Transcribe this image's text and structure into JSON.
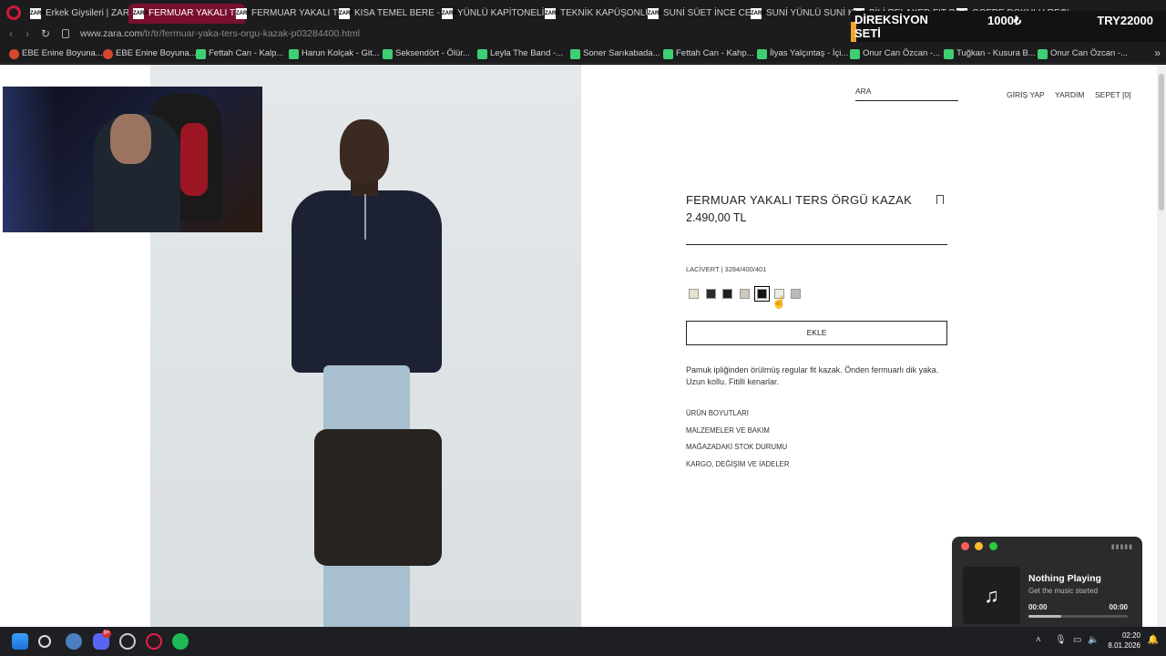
{
  "browser": {
    "tabs": [
      {
        "label": "Erkek Giysileri | ZARA",
        "active": false
      },
      {
        "label": "FERMUAR YAKALI TERS Ö",
        "active": true
      },
      {
        "label": "FERMUAR YAKALI TER",
        "active": false
      },
      {
        "label": "KISA TEMEL BERE - Z",
        "active": false
      },
      {
        "label": "YÜNLÜ KAPİTONELİ C",
        "active": false
      },
      {
        "label": "TEKNİK KAPÜŞONLU",
        "active": false
      },
      {
        "label": "SUNİ SÜET İNCE CEK",
        "active": false
      },
      {
        "label": "SUNİ YÜNLÜ SUNİ KU",
        "active": false
      },
      {
        "label": "BİLİ RELAXED FIT P",
        "active": false
      },
      {
        "label": "GOFRE DOKULU REGU",
        "active": false
      }
    ],
    "favicon_text": "ZARA",
    "url_host": "www.zara.com",
    "url_path": "/tr/tr/fermuar-yaka-ters-orgu-kazak-p03284400.html",
    "bookmarks": [
      {
        "label": "EBE Enine Boyuna...",
        "icon": "red"
      },
      {
        "label": "EBE Enine Boyuna...",
        "icon": "red"
      },
      {
        "label": "Fettah Can - Kalp...",
        "icon": "green"
      },
      {
        "label": "Harun Kolçak - Git...",
        "icon": "green"
      },
      {
        "label": "Seksendört - Ölür...",
        "icon": "green"
      },
      {
        "label": "Leyla The Band -...",
        "icon": "green"
      },
      {
        "label": "Soner Sarıkabada...",
        "icon": "green"
      },
      {
        "label": "Fettah Can - Kahp...",
        "icon": "green"
      },
      {
        "label": "İlyas Yalçıntaş - İçi...",
        "icon": "green"
      },
      {
        "label": "Onur Can Özcan -...",
        "icon": "green"
      },
      {
        "label": "Tuğkan - Kusura B...",
        "icon": "green"
      },
      {
        "label": "Onur Can Özcan -...",
        "icon": "green"
      }
    ]
  },
  "overlay": {
    "title": "DİREKSİYON SETİ",
    "amount": "1000₺",
    "total": "TRY22000",
    "accent_color": "#f2a52a"
  },
  "site": {
    "search_label": "ARA",
    "nav": [
      "GİRİŞ YAP",
      "YARDIM",
      "SEPET [0]"
    ]
  },
  "product": {
    "title": "FERMUAR YAKALI TERS ÖRGÜ KAZAK",
    "price": "2.490,00 TL",
    "color_code": "LACİVERT | 3284/400/401",
    "swatches": [
      "#e9e1cf",
      "#2e2b2b",
      "#1f1f24",
      "#cfc9bc",
      "#141418",
      "#ecebe3",
      "#b9b9b9"
    ],
    "selected_swatch": 4,
    "add_label": "EKLE",
    "description": "Pamuk ipliğinden örülmüş regular fit kazak. Önden fermuarlı dik yaka. Uzun kollu. Fitilli kenarlar.",
    "links": [
      "ÜRÜN BOYUTLARI",
      "MALZEMELER VE BAKIM",
      "MAĞAZADAKİ STOK DURUMU",
      "KARGO, DEĞİŞİM VE İADELER"
    ]
  },
  "music": {
    "title": "Nothing Playing",
    "subtitle": "Get the music started",
    "time_current": "00:00",
    "time_total": "00:00",
    "progress": 0.33
  },
  "taskbar": {
    "discord_badge": "9+",
    "time": "02:20",
    "date": "8.01.2026"
  }
}
